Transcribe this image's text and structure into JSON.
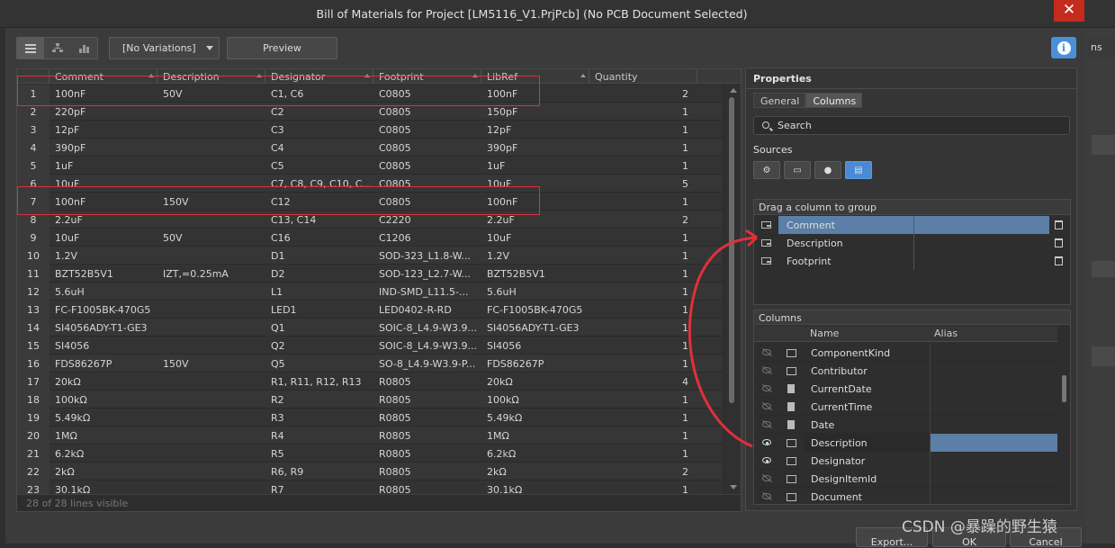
{
  "window": {
    "title": "Bill of Materials for Project [LM5116_V1.PrjPcb] (No PCB Document Selected)",
    "close_glyph": "✕"
  },
  "background_window": {
    "tab_text": "ns"
  },
  "toolbar": {
    "variations_label": "[No Variations]",
    "preview_label": "Preview",
    "info_glyph": "i"
  },
  "grid": {
    "columns": [
      "Comment",
      "Description",
      "Designator",
      "Footprint",
      "LibRef",
      "Quantity"
    ],
    "rows": [
      [
        "1",
        "100nF",
        "50V",
        "C1, C6",
        "C0805",
        "100nF",
        "2"
      ],
      [
        "2",
        "220pF",
        "",
        "C2",
        "C0805",
        "150pF",
        "1"
      ],
      [
        "3",
        "12pF",
        "",
        "C3",
        "C0805",
        "12pF",
        "1"
      ],
      [
        "4",
        "390pF",
        "",
        "C4",
        "C0805",
        "390pF",
        "1"
      ],
      [
        "5",
        "1uF",
        "",
        "C5",
        "C0805",
        "1uF",
        "1"
      ],
      [
        "6",
        "10uF",
        "",
        "C7, C8, C9, C10, C...",
        "C0805",
        "10uF",
        "5"
      ],
      [
        "7",
        "100nF",
        "150V",
        "C12",
        "C0805",
        "100nF",
        "1"
      ],
      [
        "8",
        "2.2uF",
        "",
        "C13, C14",
        "C2220",
        "2.2uF",
        "2"
      ],
      [
        "9",
        "10uF",
        "50V",
        "C16",
        "C1206",
        "10uF",
        "1"
      ],
      [
        "10",
        "1.2V",
        "",
        "D1",
        "SOD-323_L1.8-W...",
        "1.2V",
        "1"
      ],
      [
        "11",
        "BZT52B5V1",
        "IZT,=0.25mA",
        "D2",
        "SOD-123_L2.7-W...",
        "BZT52B5V1",
        "1"
      ],
      [
        "12",
        "5.6uH",
        "",
        "L1",
        "IND-SMD_L11.5-...",
        "5.6uH",
        "1"
      ],
      [
        "13",
        "FC-F1005BK-470G5",
        "",
        "LED1",
        "LED0402-R-RD",
        "FC-F1005BK-470G5",
        "1"
      ],
      [
        "14",
        "SI4056ADY-T1-GE3",
        "",
        "Q1",
        "SOIC-8_L4.9-W3.9...",
        "SI4056ADY-T1-GE3",
        "1"
      ],
      [
        "15",
        "SI4056",
        "",
        "Q2",
        "SOIC-8_L4.9-W3.9...",
        "SI4056",
        "1"
      ],
      [
        "16",
        "FDS86267P",
        "150V",
        "Q5",
        "SO-8_L4.9-W3.9-P...",
        "FDS86267P",
        "1"
      ],
      [
        "17",
        "20kΩ",
        "",
        "R1, R11, R12, R13",
        "R0805",
        "20kΩ",
        "4"
      ],
      [
        "18",
        "100kΩ",
        "",
        "R2",
        "R0805",
        "100kΩ",
        "1"
      ],
      [
        "19",
        "5.49kΩ",
        "",
        "R3",
        "R0805",
        "5.49kΩ",
        "1"
      ],
      [
        "20",
        "1MΩ",
        "",
        "R4",
        "R0805",
        "1MΩ",
        "1"
      ],
      [
        "21",
        "6.2kΩ",
        "",
        "R5",
        "R0805",
        "6.2kΩ",
        "1"
      ],
      [
        "22",
        "2kΩ",
        "",
        "R6, R9",
        "R0805",
        "2kΩ",
        "2"
      ],
      [
        "23",
        "30.1kΩ",
        "",
        "R7",
        "R0805",
        "30.1kΩ",
        "1"
      ]
    ],
    "status": "28 of 28 lines visible"
  },
  "properties": {
    "title": "Properties",
    "tabs": [
      "General",
      "Columns"
    ],
    "search_placeholder": "Search",
    "sources_label": "Sources",
    "group_header": "Drag a column to group",
    "group_rows": [
      "Comment",
      "Description",
      "Footprint"
    ],
    "columns_header": "Columns",
    "columns_subheaders": {
      "name": "Name",
      "alias": "Alias"
    },
    "column_rows": [
      {
        "name": "ComponentKind",
        "visible": false,
        "icon": "field-icon"
      },
      {
        "name": "Contributor",
        "visible": false,
        "icon": "field-icon"
      },
      {
        "name": "CurrentDate",
        "visible": false,
        "icon": "document-icon"
      },
      {
        "name": "CurrentTime",
        "visible": false,
        "icon": "document-icon"
      },
      {
        "name": "Date",
        "visible": false,
        "icon": "document-icon"
      },
      {
        "name": "Description",
        "visible": true,
        "icon": "field-icon"
      },
      {
        "name": "Designator",
        "visible": true,
        "icon": "field-icon"
      },
      {
        "name": "DesignItemId",
        "visible": false,
        "icon": "field-icon"
      },
      {
        "name": "Document",
        "visible": false,
        "icon": "field-icon"
      }
    ]
  },
  "buttons": {
    "export": "Export...",
    "ok": "OK",
    "cancel": "Cancel"
  },
  "watermark": "CSDN @暴躁的野生猿",
  "colors": {
    "selection": "#5b7fa6",
    "annotation_red": "#e0303a",
    "info_blue": "#4a90d9",
    "close_red": "#c42b1c"
  }
}
